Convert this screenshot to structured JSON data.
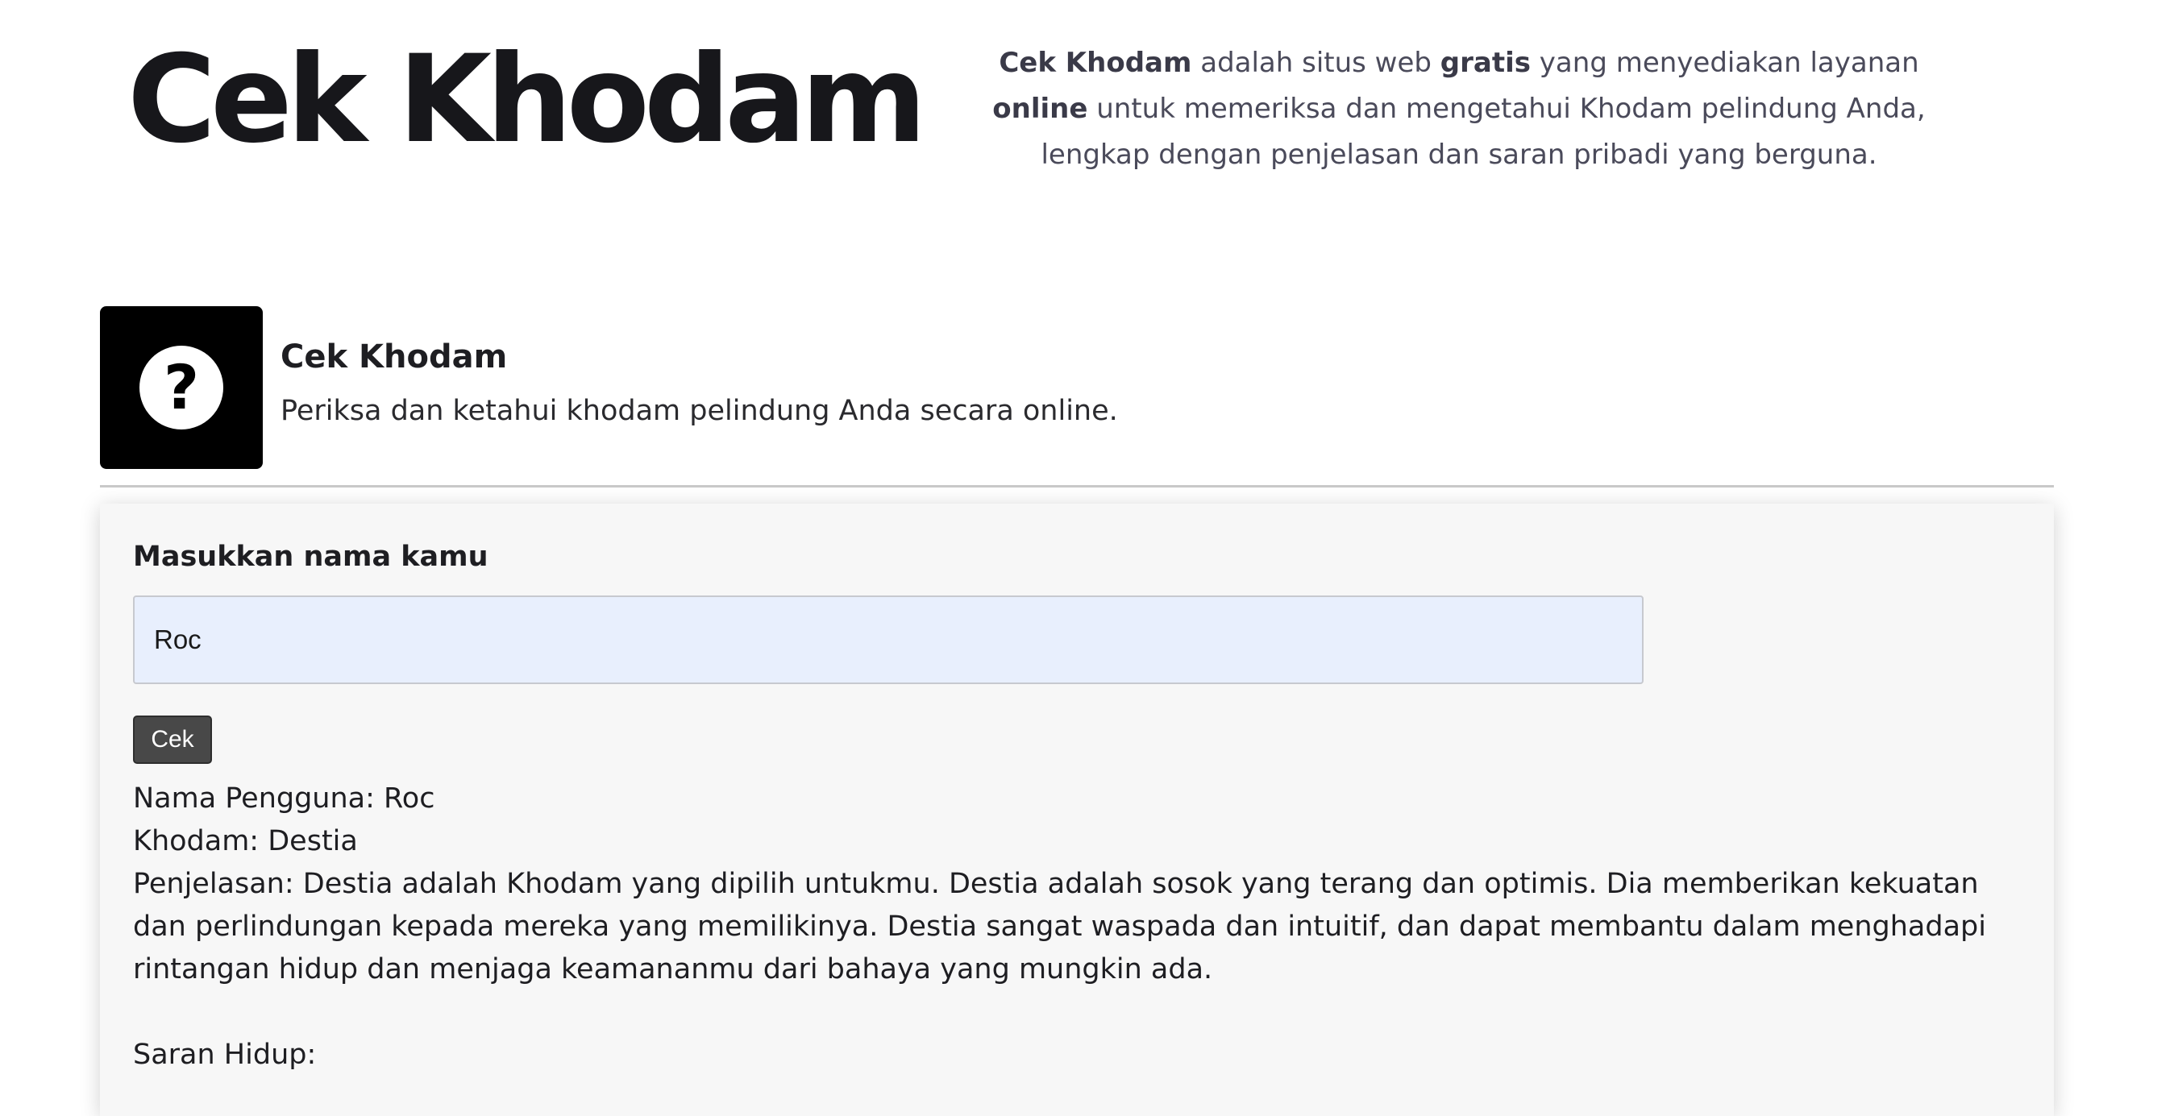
{
  "hero": {
    "title": "Cek Khodam",
    "description": {
      "part1": "Cek Khodam",
      "part2": " adalah situs web ",
      "part3": "gratis",
      "part4": " yang menyediakan layanan ",
      "part5": "online",
      "part6": " untuk memeriksa dan mengetahui Khodam pelindung Anda, lengkap dengan penjelasan dan saran pribadi yang berguna."
    }
  },
  "tool": {
    "icon": "question-mark-icon",
    "icon_glyph": "?",
    "title": "Cek Khodam",
    "subtitle": "Periksa dan ketahui khodam pelindung Anda secara online."
  },
  "form": {
    "label": "Masukkan nama kamu",
    "input_value": "Roc",
    "button_label": "Cek"
  },
  "result": {
    "name_line": "Nama Pengguna: Roc",
    "khodam_line": "Khodam: Destia",
    "explanation": "Penjelasan: Destia adalah Khodam yang dipilih untukmu. Destia adalah sosok yang terang dan optimis. Dia memberikan kekuatan dan perlindungan kepada mereka yang memilikinya. Destia sangat waspada dan intuitif, dan dapat membantu dalam menghadapi rintangan hidup dan menjaga keamananmu dari bahaya yang mungkin ada.",
    "advice_heading": "Saran Hidup:"
  },
  "colors": {
    "icon_box": "#000000",
    "input_background": "#e8effd",
    "button_background": "#484848",
    "panel_background": "#f7f7f7"
  }
}
